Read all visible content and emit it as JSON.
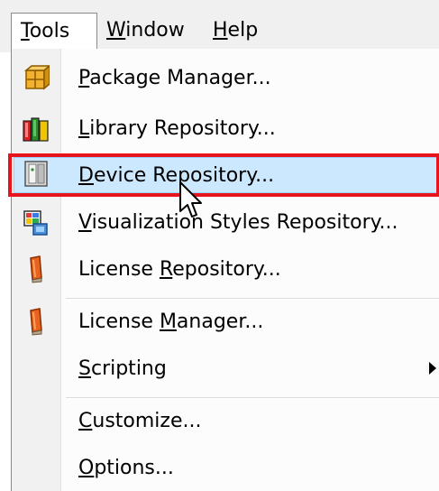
{
  "menubar": {
    "tools": {
      "pre": "",
      "u": "T",
      "post": "ools"
    },
    "window": {
      "pre": "",
      "u": "W",
      "post": "indow"
    },
    "help": {
      "pre": "",
      "u": "H",
      "post": "elp"
    }
  },
  "menu": {
    "items": [
      {
        "pre": "",
        "u": "P",
        "post": "ackage Manager...",
        "icon": "package-icon"
      },
      {
        "pre": "",
        "u": "L",
        "post": "ibrary Repository...",
        "icon": "library-icon"
      },
      {
        "pre": "",
        "u": "D",
        "post": "evice Repository...",
        "icon": "device-icon",
        "highlighted": true
      },
      {
        "pre": "",
        "u": "V",
        "post": "isualization Styles Repository...",
        "icon": "visualization-icon"
      },
      {
        "pre": "License ",
        "u": "R",
        "post": "epository...",
        "icon": "license-icon"
      },
      {
        "pre": "License ",
        "u": "M",
        "post": "anager...",
        "icon": "license-manager-icon"
      },
      {
        "pre": "",
        "u": "S",
        "post": "cripting",
        "icon": "",
        "submenu": true
      },
      {
        "pre": "",
        "u": "C",
        "post": "ustomize...",
        "icon": ""
      },
      {
        "pre": "",
        "u": "O",
        "post": "ptions...",
        "icon": ""
      }
    ]
  },
  "colors": {
    "highlight_bg": "#cce8ff",
    "highlight_border": "#99d1ff",
    "annotation_frame": "#e8141d"
  }
}
